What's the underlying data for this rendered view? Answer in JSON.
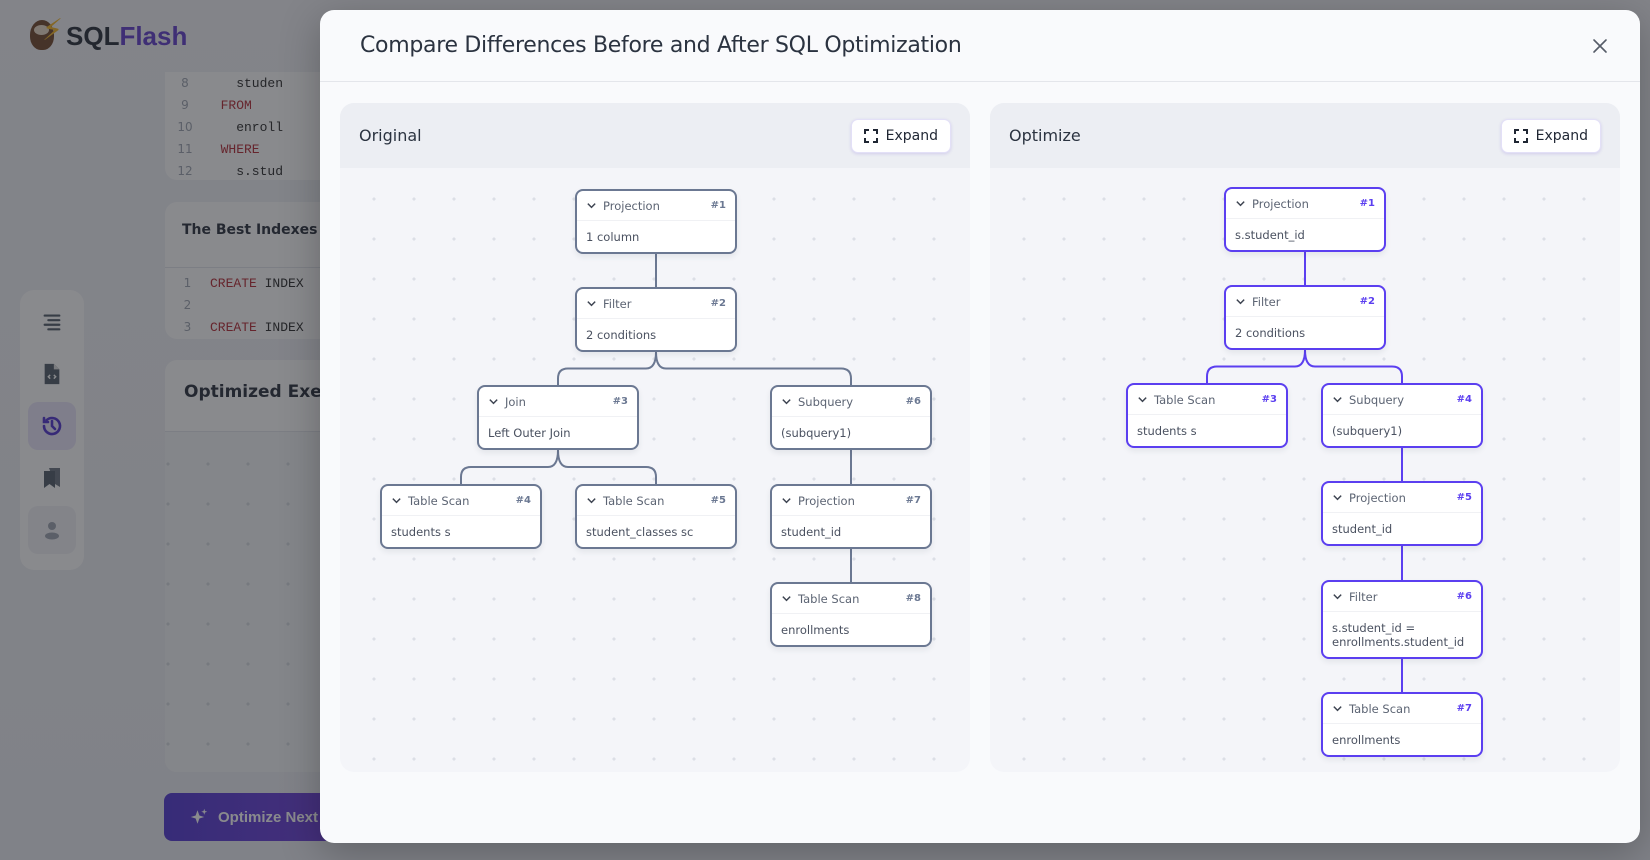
{
  "app": {
    "logo_prefix": "SQL",
    "logo_suffix": "Flash",
    "code_lines": [
      {
        "num": "8",
        "kw": "",
        "text": "    studen"
      },
      {
        "num": "9",
        "kw": "  FROM",
        "text": ""
      },
      {
        "num": "10",
        "kw": "",
        "text": "    enroll"
      },
      {
        "num": "11",
        "kw": "  WHERE",
        "text": ""
      },
      {
        "num": "12",
        "kw": "",
        "text": "    s.stud"
      }
    ],
    "indexes_title": "The Best Indexes for",
    "index_lines": [
      {
        "num": "1",
        "kw": "CREATE",
        "text": " INDEX"
      },
      {
        "num": "2",
        "kw": "",
        "text": ""
      },
      {
        "num": "3",
        "kw": "CREATE",
        "text": " INDEX"
      }
    ],
    "exec_title": "Optimized Execut",
    "optimize_next_label": "Optimize Next",
    "sidebar": [
      {
        "icon": "align-right-icon",
        "active": false
      },
      {
        "icon": "file-code-icon",
        "active": false
      },
      {
        "icon": "history-icon",
        "active": true
      },
      {
        "icon": "bookmarks-icon",
        "active": false
      },
      {
        "icon": "user-icon",
        "active": false
      }
    ]
  },
  "modal": {
    "title": "Compare Differences Before and After SQL Optimization",
    "close_icon": "close-icon",
    "panels": {
      "original": {
        "title": "Original",
        "expand_label": "Expand",
        "nodes": [
          {
            "id": "1",
            "type": "Projection",
            "detail": "1 column"
          },
          {
            "id": "2",
            "type": "Filter",
            "detail": "2 conditions"
          },
          {
            "id": "3",
            "type": "Join",
            "detail": "Left Outer Join"
          },
          {
            "id": "4",
            "type": "Table Scan",
            "detail": "students s"
          },
          {
            "id": "5",
            "type": "Table Scan",
            "detail": "student_classes sc"
          },
          {
            "id": "6",
            "type": "Subquery",
            "detail": "(subquery1)"
          },
          {
            "id": "7",
            "type": "Projection",
            "detail": "student_id"
          },
          {
            "id": "8",
            "type": "Table Scan",
            "detail": "enrollments"
          }
        ],
        "edges": [
          [
            "1",
            "2"
          ],
          [
            "2",
            "3"
          ],
          [
            "2",
            "6"
          ],
          [
            "3",
            "4"
          ],
          [
            "3",
            "5"
          ],
          [
            "6",
            "7"
          ],
          [
            "7",
            "8"
          ]
        ]
      },
      "optimized": {
        "title": "Optimize",
        "expand_label": "Expand",
        "nodes": [
          {
            "id": "1",
            "type": "Projection",
            "detail": "s.student_id"
          },
          {
            "id": "2",
            "type": "Filter",
            "detail": "2 conditions"
          },
          {
            "id": "3",
            "type": "Table Scan",
            "detail": "students s"
          },
          {
            "id": "4",
            "type": "Subquery",
            "detail": "(subquery1)"
          },
          {
            "id": "5",
            "type": "Projection",
            "detail": "student_id"
          },
          {
            "id": "6",
            "type": "Filter",
            "detail": "s.student_id = enrollments.student_id"
          },
          {
            "id": "7",
            "type": "Table Scan",
            "detail": "enrollments"
          }
        ],
        "edges": [
          [
            "1",
            "2"
          ],
          [
            "2",
            "3"
          ],
          [
            "2",
            "4"
          ],
          [
            "4",
            "5"
          ],
          [
            "5",
            "6"
          ],
          [
            "6",
            "7"
          ]
        ]
      }
    }
  },
  "colors": {
    "accent": "#5b3ff0",
    "original_border": "#6b7892",
    "brand": "#5b35c9"
  }
}
